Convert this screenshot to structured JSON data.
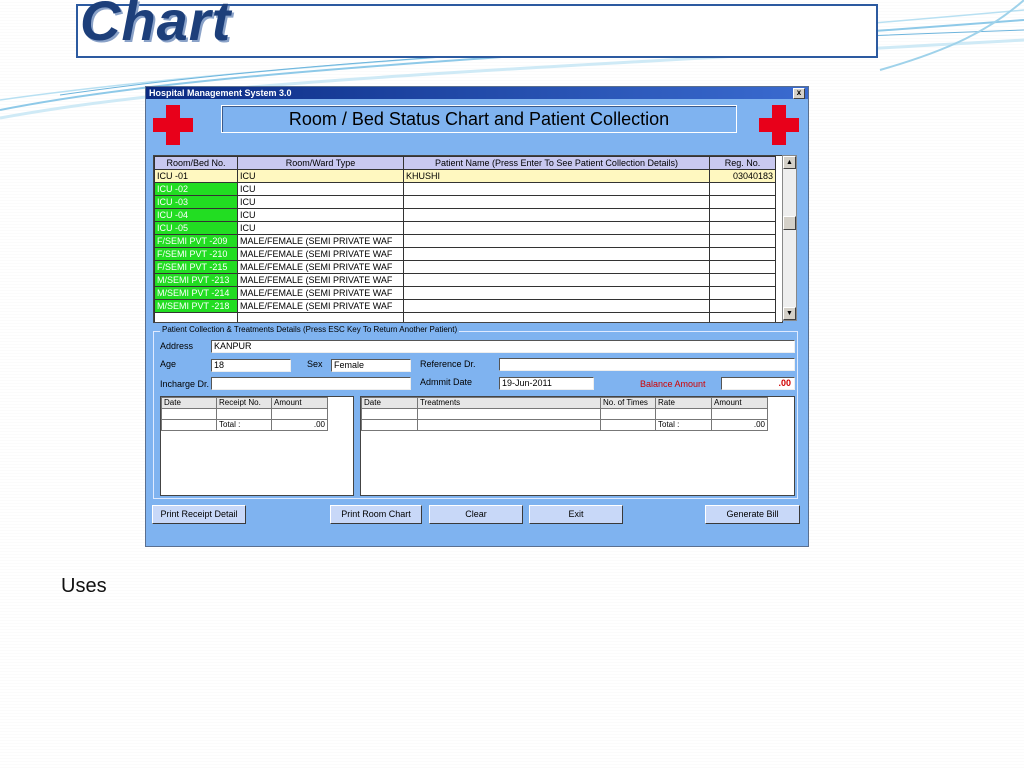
{
  "slide": {
    "title": "Chart",
    "body_text": "Uses"
  },
  "window": {
    "title": "Hospital Management System 3.0",
    "close_glyph": "x",
    "heading": "Room / Bed Status Chart and Patient Collection"
  },
  "bed_grid": {
    "columns": [
      "Room/Bed No.",
      "Room/Ward Type",
      "Patient Name (Press Enter To See Patient Collection Details)",
      "Reg. No."
    ],
    "rows": [
      {
        "bed": "ICU -01",
        "type": "ICU",
        "patient": "KHUSHI",
        "reg": "03040183",
        "status": "occupied"
      },
      {
        "bed": "ICU -02",
        "type": "ICU",
        "patient": "",
        "reg": "",
        "status": "free"
      },
      {
        "bed": "ICU -03",
        "type": "ICU",
        "patient": "",
        "reg": "",
        "status": "free"
      },
      {
        "bed": "ICU -04",
        "type": "ICU",
        "patient": "",
        "reg": "",
        "status": "free"
      },
      {
        "bed": "ICU -05",
        "type": "ICU",
        "patient": "",
        "reg": "",
        "status": "free"
      },
      {
        "bed": "F/SEMI PVT -209",
        "type": "MALE/FEMALE (SEMI PRIVATE WAF",
        "patient": "",
        "reg": "",
        "status": "free"
      },
      {
        "bed": "F/SEMI PVT -210",
        "type": "MALE/FEMALE (SEMI PRIVATE WAF",
        "patient": "",
        "reg": "",
        "status": "free"
      },
      {
        "bed": "F/SEMI PVT -215",
        "type": "MALE/FEMALE (SEMI PRIVATE WAF",
        "patient": "",
        "reg": "",
        "status": "free"
      },
      {
        "bed": "M/SEMI PVT -213",
        "type": "MALE/FEMALE (SEMI PRIVATE WAF",
        "patient": "",
        "reg": "",
        "status": "free"
      },
      {
        "bed": "M/SEMI PVT -214",
        "type": "MALE/FEMALE (SEMI PRIVATE WAF",
        "patient": "",
        "reg": "",
        "status": "free"
      },
      {
        "bed": "M/SEMI PVT -218",
        "type": "MALE/FEMALE (SEMI PRIVATE WAF",
        "patient": "",
        "reg": "",
        "status": "free"
      }
    ],
    "colors": {
      "free": "#22dd22",
      "selected": "#fff8c0",
      "header": "#c8c8f0"
    }
  },
  "details": {
    "group_label": "Patient Collection & Treatments Details (Press ESC Key To Return Another Patient)",
    "address_label": "Address",
    "address_value": "KANPUR",
    "age_label": "Age",
    "age_value": "18",
    "sex_label": "Sex",
    "sex_value": "Female",
    "reference_label": "Reference Dr.",
    "reference_value": "",
    "incharge_label": "Incharge Dr.",
    "incharge_value": "",
    "admit_label": "Admmit Date",
    "admit_value": "19-Jun-2011",
    "balance_label": "Balance Amount",
    "balance_value": ".00"
  },
  "receipts": {
    "columns": [
      "Date",
      "Receipt No.",
      "Amount"
    ],
    "total_label": "Total :",
    "total_value": ".00"
  },
  "treatments": {
    "columns": [
      "Date",
      "Treatments",
      "No. of Times",
      "Rate",
      "Amount"
    ],
    "total_label": "Total :",
    "total_value": ".00"
  },
  "buttons": {
    "print_receipt": "Print Receipt Detail",
    "print_room": "Print Room Chart",
    "clear": "Clear",
    "exit": "Exit",
    "generate_bill": "Generate Bill"
  },
  "theme": {
    "window_bg": "#7fb3f0",
    "cross_red": "#e8001a",
    "title_blue": "#1d3f7a"
  },
  "icons": [
    "red-cross-icon",
    "close-icon",
    "scroll-up-icon",
    "scroll-down-icon"
  ]
}
